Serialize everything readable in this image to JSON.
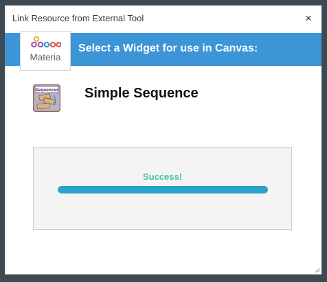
{
  "dialog": {
    "title": "Link Resource from External Tool",
    "close_symbol": "×",
    "close_icon": "close-icon"
  },
  "banner": {
    "heading": "Select a Widget for use in Canvas:",
    "color": "#3c95d7"
  },
  "logo": {
    "text": "Materia",
    "icon": "materia-logo-icon"
  },
  "widget": {
    "name": "Simple Sequence",
    "icon_label": "Sequencer",
    "icon": "simple-sequence-widget-icon"
  },
  "status": {
    "message": "Success!",
    "progress": 1.0,
    "message_color": "#49c591",
    "bar_color": "#2aa3cb"
  }
}
